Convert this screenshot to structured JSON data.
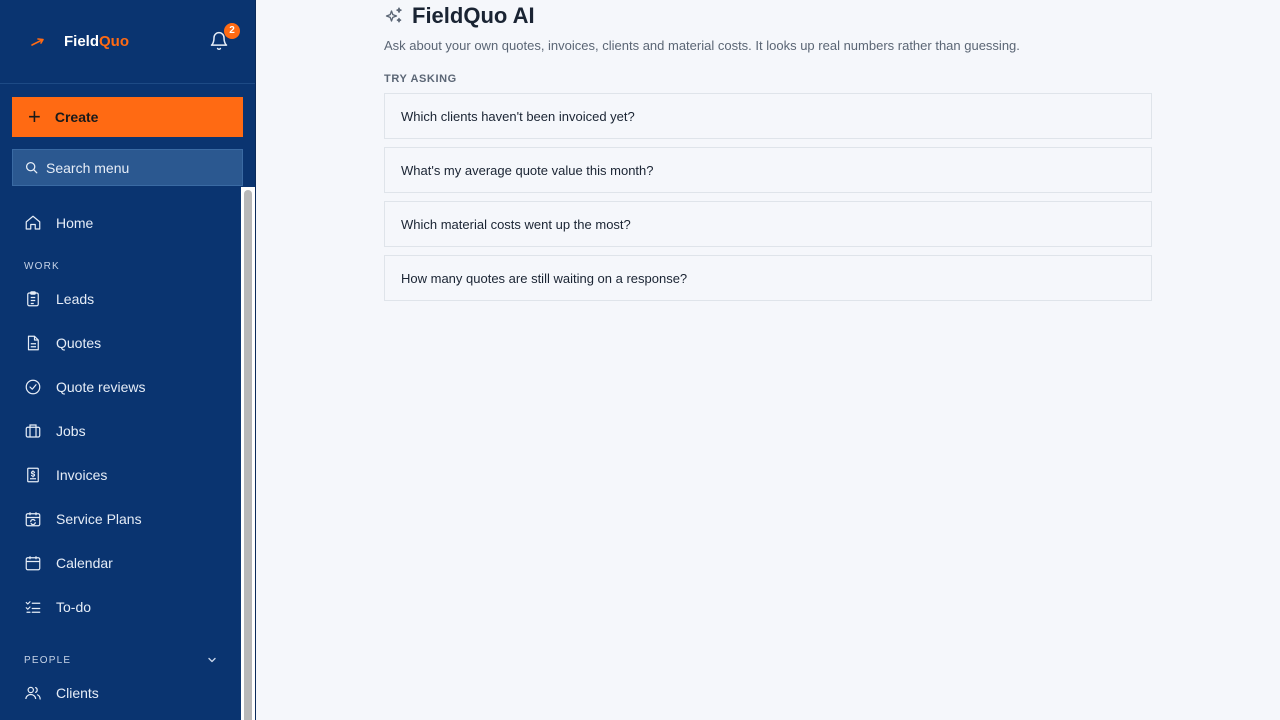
{
  "brand": {
    "name_part1": "Field",
    "name_part2": "Quo",
    "accent": "#ff6a13",
    "sidebar_bg": "#0a3470"
  },
  "header": {
    "notification_count": "2"
  },
  "sidebar": {
    "create_label": "Create",
    "search_placeholder": "Search menu",
    "home_label": "Home",
    "work_section": "WORK",
    "work_items": [
      "Leads",
      "Quotes",
      "Quote reviews",
      "Jobs",
      "Invoices",
      "Service Plans",
      "Calendar",
      "To-do"
    ],
    "people_section": "PEOPLE",
    "people_items": [
      "Clients"
    ]
  },
  "main": {
    "title": "FieldQuo AI",
    "subtitle": "Ask about your own quotes, invoices, clients and material costs. It looks up real numbers rather than guessing.",
    "try_label": "TRY ASKING",
    "suggestions": [
      "Which clients haven't been invoiced yet?",
      "What's my average quote value this month?",
      "Which material costs went up the most?",
      "How many quotes are still waiting on a response?"
    ]
  }
}
